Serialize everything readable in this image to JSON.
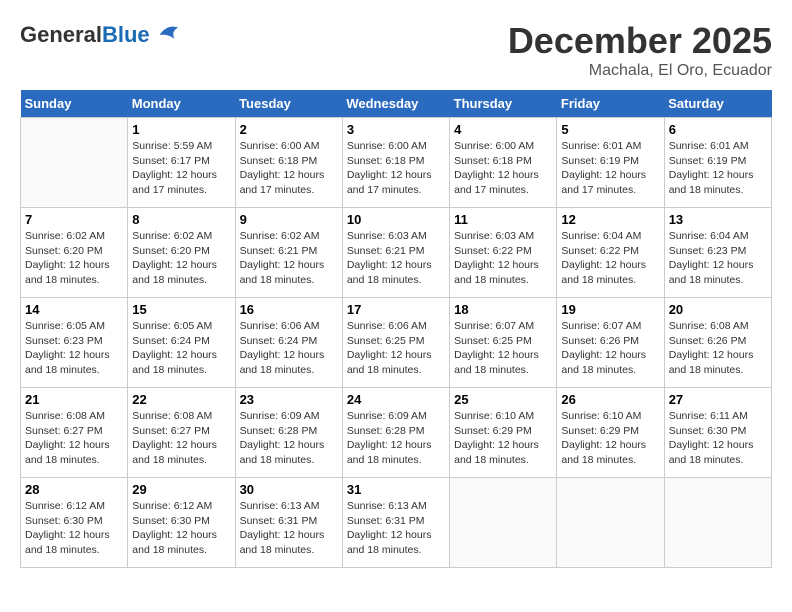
{
  "logo": {
    "general": "General",
    "blue": "Blue"
  },
  "title": "December 2025",
  "subtitle": "Machala, El Oro, Ecuador",
  "days_of_week": [
    "Sunday",
    "Monday",
    "Tuesday",
    "Wednesday",
    "Thursday",
    "Friday",
    "Saturday"
  ],
  "weeks": [
    [
      {
        "num": "",
        "info": ""
      },
      {
        "num": "1",
        "info": "Sunrise: 5:59 AM\nSunset: 6:17 PM\nDaylight: 12 hours\nand 17 minutes."
      },
      {
        "num": "2",
        "info": "Sunrise: 6:00 AM\nSunset: 6:18 PM\nDaylight: 12 hours\nand 17 minutes."
      },
      {
        "num": "3",
        "info": "Sunrise: 6:00 AM\nSunset: 6:18 PM\nDaylight: 12 hours\nand 17 minutes."
      },
      {
        "num": "4",
        "info": "Sunrise: 6:00 AM\nSunset: 6:18 PM\nDaylight: 12 hours\nand 17 minutes."
      },
      {
        "num": "5",
        "info": "Sunrise: 6:01 AM\nSunset: 6:19 PM\nDaylight: 12 hours\nand 17 minutes."
      },
      {
        "num": "6",
        "info": "Sunrise: 6:01 AM\nSunset: 6:19 PM\nDaylight: 12 hours\nand 18 minutes."
      }
    ],
    [
      {
        "num": "7",
        "info": "Sunrise: 6:02 AM\nSunset: 6:20 PM\nDaylight: 12 hours\nand 18 minutes."
      },
      {
        "num": "8",
        "info": "Sunrise: 6:02 AM\nSunset: 6:20 PM\nDaylight: 12 hours\nand 18 minutes."
      },
      {
        "num": "9",
        "info": "Sunrise: 6:02 AM\nSunset: 6:21 PM\nDaylight: 12 hours\nand 18 minutes."
      },
      {
        "num": "10",
        "info": "Sunrise: 6:03 AM\nSunset: 6:21 PM\nDaylight: 12 hours\nand 18 minutes."
      },
      {
        "num": "11",
        "info": "Sunrise: 6:03 AM\nSunset: 6:22 PM\nDaylight: 12 hours\nand 18 minutes."
      },
      {
        "num": "12",
        "info": "Sunrise: 6:04 AM\nSunset: 6:22 PM\nDaylight: 12 hours\nand 18 minutes."
      },
      {
        "num": "13",
        "info": "Sunrise: 6:04 AM\nSunset: 6:23 PM\nDaylight: 12 hours\nand 18 minutes."
      }
    ],
    [
      {
        "num": "14",
        "info": "Sunrise: 6:05 AM\nSunset: 6:23 PM\nDaylight: 12 hours\nand 18 minutes."
      },
      {
        "num": "15",
        "info": "Sunrise: 6:05 AM\nSunset: 6:24 PM\nDaylight: 12 hours\nand 18 minutes."
      },
      {
        "num": "16",
        "info": "Sunrise: 6:06 AM\nSunset: 6:24 PM\nDaylight: 12 hours\nand 18 minutes."
      },
      {
        "num": "17",
        "info": "Sunrise: 6:06 AM\nSunset: 6:25 PM\nDaylight: 12 hours\nand 18 minutes."
      },
      {
        "num": "18",
        "info": "Sunrise: 6:07 AM\nSunset: 6:25 PM\nDaylight: 12 hours\nand 18 minutes."
      },
      {
        "num": "19",
        "info": "Sunrise: 6:07 AM\nSunset: 6:26 PM\nDaylight: 12 hours\nand 18 minutes."
      },
      {
        "num": "20",
        "info": "Sunrise: 6:08 AM\nSunset: 6:26 PM\nDaylight: 12 hours\nand 18 minutes."
      }
    ],
    [
      {
        "num": "21",
        "info": "Sunrise: 6:08 AM\nSunset: 6:27 PM\nDaylight: 12 hours\nand 18 minutes."
      },
      {
        "num": "22",
        "info": "Sunrise: 6:08 AM\nSunset: 6:27 PM\nDaylight: 12 hours\nand 18 minutes."
      },
      {
        "num": "23",
        "info": "Sunrise: 6:09 AM\nSunset: 6:28 PM\nDaylight: 12 hours\nand 18 minutes."
      },
      {
        "num": "24",
        "info": "Sunrise: 6:09 AM\nSunset: 6:28 PM\nDaylight: 12 hours\nand 18 minutes."
      },
      {
        "num": "25",
        "info": "Sunrise: 6:10 AM\nSunset: 6:29 PM\nDaylight: 12 hours\nand 18 minutes."
      },
      {
        "num": "26",
        "info": "Sunrise: 6:10 AM\nSunset: 6:29 PM\nDaylight: 12 hours\nand 18 minutes."
      },
      {
        "num": "27",
        "info": "Sunrise: 6:11 AM\nSunset: 6:30 PM\nDaylight: 12 hours\nand 18 minutes."
      }
    ],
    [
      {
        "num": "28",
        "info": "Sunrise: 6:12 AM\nSunset: 6:30 PM\nDaylight: 12 hours\nand 18 minutes."
      },
      {
        "num": "29",
        "info": "Sunrise: 6:12 AM\nSunset: 6:30 PM\nDaylight: 12 hours\nand 18 minutes."
      },
      {
        "num": "30",
        "info": "Sunrise: 6:13 AM\nSunset: 6:31 PM\nDaylight: 12 hours\nand 18 minutes."
      },
      {
        "num": "31",
        "info": "Sunrise: 6:13 AM\nSunset: 6:31 PM\nDaylight: 12 hours\nand 18 minutes."
      },
      {
        "num": "",
        "info": ""
      },
      {
        "num": "",
        "info": ""
      },
      {
        "num": "",
        "info": ""
      }
    ]
  ]
}
